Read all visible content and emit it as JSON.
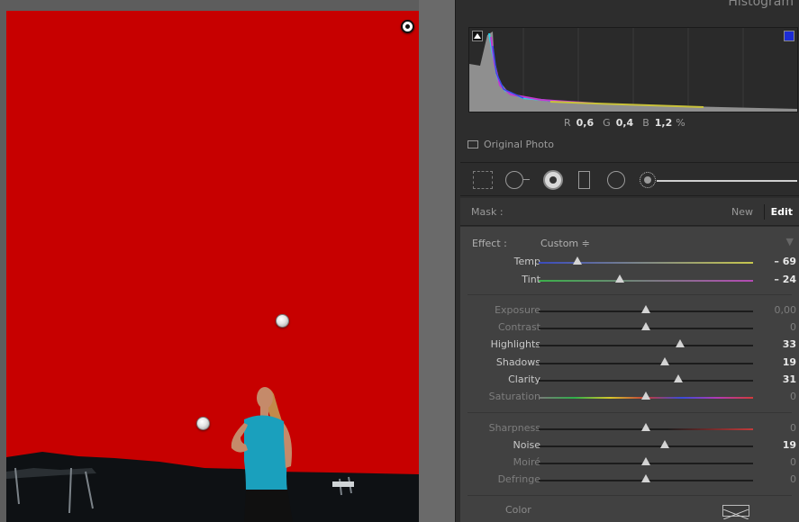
{
  "panel": {
    "histogram_title": "Histogram",
    "rgb_readout": {
      "r_label": "R",
      "r_value": "0,6",
      "g_label": "G",
      "g_value": "0,4",
      "b_label": "B",
      "b_value": "1,2",
      "unit": "%"
    },
    "original_photo_label": "Original Photo"
  },
  "tools": [
    "crop-overlay-icon",
    "spot-removal-icon",
    "red-eye-icon",
    "graduated-filter-icon",
    "radial-filter-icon",
    "adjustment-brush-icon"
  ],
  "mask": {
    "label": "Mask :",
    "new": "New",
    "edit": "Edit"
  },
  "effect": {
    "label": "Effect :",
    "preset": "Custom ≑",
    "collapse_icon": "▼",
    "sliders": [
      {
        "name": "temp",
        "label": "Temp",
        "value": "– 69",
        "position": 0.18,
        "track": "linear-gradient(90deg,#3a4bbd,#c7c74e)",
        "active": true
      },
      {
        "name": "tint",
        "label": "Tint",
        "value": "– 24",
        "position": 0.38,
        "track": "linear-gradient(90deg,#3bb04a,#b44ab4)",
        "active": true
      },
      {
        "name": "exposure",
        "label": "Exposure",
        "value": "0,00",
        "position": 0.5,
        "track": "",
        "active": false
      },
      {
        "name": "contrast",
        "label": "Contrast",
        "value": "0",
        "position": 0.5,
        "track": "",
        "active": false
      },
      {
        "name": "highlights",
        "label": "Highlights",
        "value": "33",
        "position": 0.66,
        "track": "",
        "active": true
      },
      {
        "name": "shadows",
        "label": "Shadows",
        "value": "19",
        "position": 0.59,
        "track": "",
        "active": true
      },
      {
        "name": "clarity",
        "label": "Clarity",
        "value": "31",
        "position": 0.65,
        "track": "",
        "active": true
      },
      {
        "name": "saturation",
        "label": "Saturation",
        "value": "0",
        "position": 0.5,
        "track": "linear-gradient(90deg,#7a7a7a,#2fb04a,#d6c72b,#c23a3a,#3a4bd8,#b23ab2,#d33a3a)",
        "active": false
      },
      {
        "name": "sharpness",
        "label": "Sharpness",
        "value": "0",
        "position": 0.5,
        "track": "linear-gradient(90deg,#1c1c1c 60%,#c23a3a)",
        "active": false
      },
      {
        "name": "noise",
        "label": "Noise",
        "value": "19",
        "position": 0.59,
        "track": "",
        "active": true
      },
      {
        "name": "moire",
        "label": "Moiré",
        "value": "0",
        "position": 0.5,
        "track": "",
        "active": false
      },
      {
        "name": "defringe",
        "label": "Defringe",
        "value": "0",
        "position": 0.5,
        "track": "",
        "active": false
      }
    ],
    "color_label": "Color"
  },
  "colors": {
    "mask_overlay": "#c70000",
    "panel_bg": "#414141"
  }
}
